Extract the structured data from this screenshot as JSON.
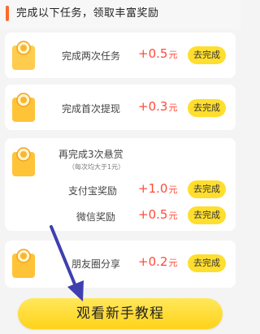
{
  "header": {
    "title": "完成以下任务，领取丰富奖励"
  },
  "tasks": [
    {
      "label": "完成两次任务",
      "amount": "+0.5",
      "unit": "元",
      "button": "去完成"
    },
    {
      "label": "完成首次提现",
      "amount": "+0.3",
      "unit": "元",
      "button": "去完成"
    },
    {
      "label": "再完成3次悬赏",
      "note": "（每次均大于1元）",
      "subs": [
        {
          "label": "支付宝奖励",
          "amount": "+1.0",
          "unit": "元",
          "button": "去完成"
        },
        {
          "label": "微信奖励",
          "amount": "+0.5",
          "unit": "元",
          "button": "去完成"
        }
      ]
    },
    {
      "label": "朋友圈分享",
      "amount": "+0.2",
      "unit": "元",
      "button": "去完成"
    }
  ],
  "footer": {
    "button": "观看新手教程"
  },
  "colors": {
    "accent": "#ff6a2a",
    "reward": "#ff4b3a",
    "button": "#ffde2e",
    "arrow": "#3f3fb0"
  }
}
